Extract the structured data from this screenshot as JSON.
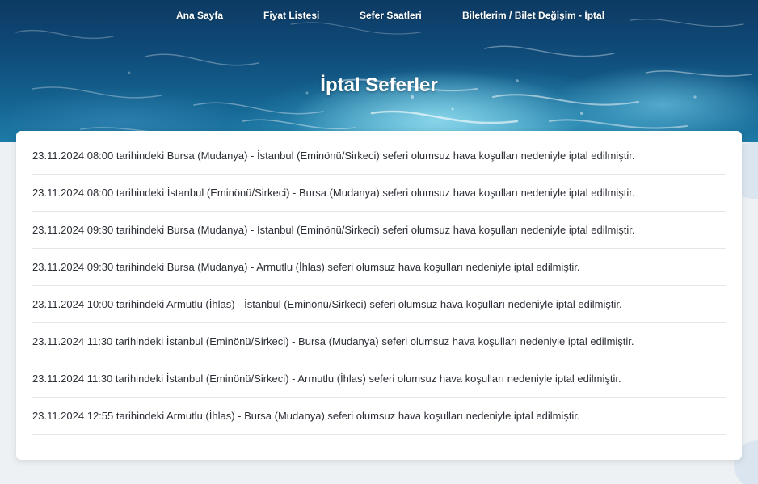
{
  "nav": {
    "items": [
      {
        "label": "Ana Sayfa"
      },
      {
        "label": "Fiyat Listesi"
      },
      {
        "label": "Sefer Saatleri"
      },
      {
        "label": "Biletlerim / Bilet Değişim - İptal"
      }
    ]
  },
  "hero": {
    "title": "İptal Seferler"
  },
  "cancellations": [
    "23.11.2024 08:00 tarihindeki Bursa (Mudanya) - İstanbul (Eminönü/Sirkeci) seferi olumsuz hava koşulları nedeniyle iptal edilmiştir.",
    "23.11.2024 08:00 tarihindeki İstanbul (Eminönü/Sirkeci) - Bursa (Mudanya) seferi olumsuz hava koşulları nedeniyle iptal edilmiştir.",
    "23.11.2024 09:30 tarihindeki Bursa (Mudanya) - İstanbul (Eminönü/Sirkeci) seferi olumsuz hava koşulları nedeniyle iptal edilmiştir.",
    "23.11.2024 09:30 tarihindeki Bursa (Mudanya) - Armutlu (İhlas) seferi olumsuz hava koşulları nedeniyle iptal edilmiştir.",
    "23.11.2024 10:00 tarihindeki Armutlu (İhlas) - İstanbul (Eminönü/Sirkeci) seferi olumsuz hava koşulları nedeniyle iptal edilmiştir.",
    "23.11.2024 11:30 tarihindeki İstanbul (Eminönü/Sirkeci) - Bursa (Mudanya) seferi olumsuz hava koşulları nedeniyle iptal edilmiştir.",
    "23.11.2024 11:30 tarihindeki İstanbul (Eminönü/Sirkeci) - Armutlu (İhlas) seferi olumsuz hava koşulları nedeniyle iptal edilmiştir.",
    "23.11.2024 12:55 tarihindeki Armutlu (İhlas) - Bursa (Mudanya) seferi olumsuz hava koşulları nedeniyle iptal edilmiştir."
  ],
  "colors": {
    "text": "#2b2f36",
    "divider": "#e3e6ea",
    "page_background": "#eef1f4"
  }
}
